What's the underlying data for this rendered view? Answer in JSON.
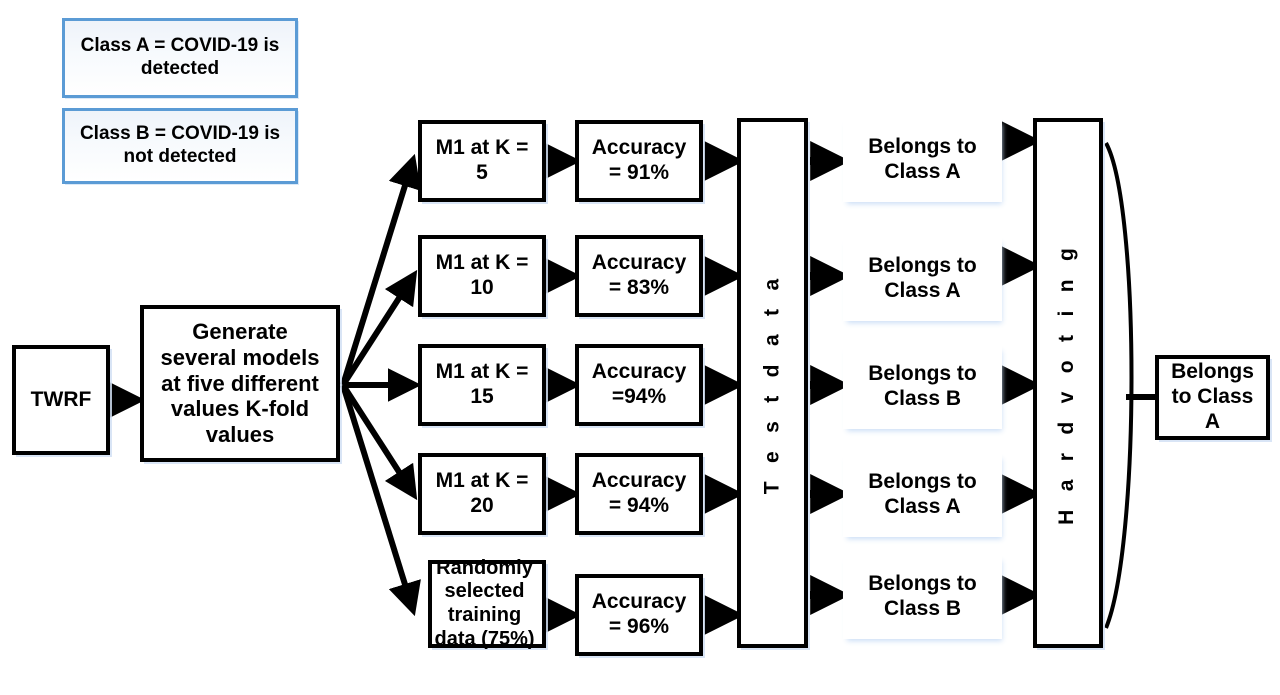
{
  "legend": [
    {
      "id": "class-a",
      "text": "Class A  = COVID-19 is detected"
    },
    {
      "id": "class-b",
      "text": "Class B  = COVID-19 is not detected"
    }
  ],
  "input": {
    "label": "TWRF"
  },
  "generator": {
    "label": "Generate several models at five different values K-fold values"
  },
  "models": [
    {
      "model": "M1 at K = 5",
      "accuracy": "Accuracy = 91%",
      "prediction": "Belongs to Class A"
    },
    {
      "model": "M1 at K = 10",
      "accuracy": "Accuracy = 83%",
      "prediction": "Belongs to Class A"
    },
    {
      "model": "M1 at K = 15",
      "accuracy": "Accuracy =94%",
      "prediction": "Belongs to Class B"
    },
    {
      "model": "M1 at K = 20",
      "accuracy": "Accuracy = 94%",
      "prediction": "Belongs to Class A"
    },
    {
      "model": "Randomly selected training data (75%)",
      "accuracy": "Accuracy = 96%",
      "prediction": "Belongs to Class B"
    }
  ],
  "test_data": {
    "label": "T e s t  d a t a"
  },
  "voting": {
    "label": "H a r d  v o t i n g"
  },
  "output": {
    "label": "Belongs to Class A"
  },
  "colors": {
    "stroke": "#000000",
    "legend_border": "#5B9BD5",
    "legend_fill": "#eef3fa",
    "background": "#ffffff"
  }
}
